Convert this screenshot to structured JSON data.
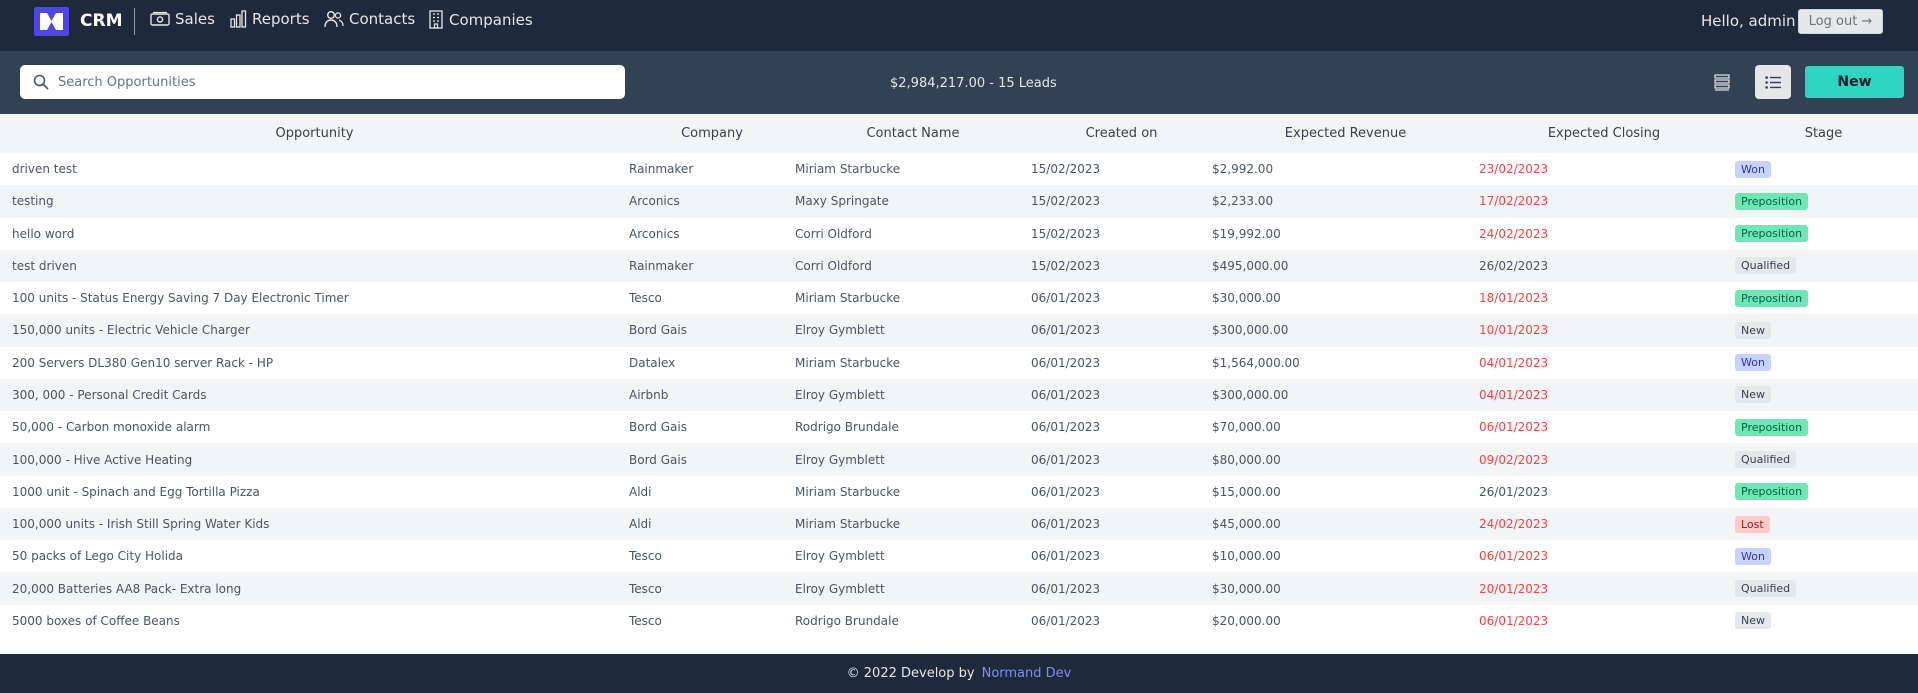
{
  "nav": {
    "brand": "CRM",
    "items": [
      {
        "label": "Sales",
        "icon": "money-icon"
      },
      {
        "label": "Reports",
        "icon": "bar-chart-icon"
      },
      {
        "label": "Contacts",
        "icon": "users-icon"
      },
      {
        "label": "Companies",
        "icon": "building-icon"
      }
    ],
    "greeting": "Hello, admin",
    "logout_label": "Log out →"
  },
  "toolbar": {
    "search_placeholder": "Search Opportunities",
    "summary": "$2,984,217.00 - 15 Leads",
    "new_label": "New"
  },
  "table": {
    "headers": [
      "Opportunity",
      "Company",
      "Contact Name",
      "Created on",
      "Expected Revenue",
      "Expected Closing",
      "Stage"
    ],
    "rows": [
      {
        "opportunity": "driven test",
        "company": "Rainmaker",
        "contact": "Miriam Starbucke",
        "created": "15/02/2023",
        "revenue": "$2,992.00",
        "closing": "23/02/2023",
        "closing_late": true,
        "stage": "Won"
      },
      {
        "opportunity": "testing",
        "company": "Arconics",
        "contact": "Maxy Springate",
        "created": "15/02/2023",
        "revenue": "$2,233.00",
        "closing": "17/02/2023",
        "closing_late": true,
        "stage": "Preposition"
      },
      {
        "opportunity": "hello word",
        "company": "Arconics",
        "contact": "Corri Oldford",
        "created": "15/02/2023",
        "revenue": "$19,992.00",
        "closing": "24/02/2023",
        "closing_late": true,
        "stage": "Preposition"
      },
      {
        "opportunity": "test driven",
        "company": "Rainmaker",
        "contact": "Corri Oldford",
        "created": "15/02/2023",
        "revenue": "$495,000.00",
        "closing": "26/02/2023",
        "closing_late": false,
        "stage": "Qualified"
      },
      {
        "opportunity": "100 units - Status Energy Saving 7 Day Electronic Timer",
        "company": "Tesco",
        "contact": "Miriam Starbucke",
        "created": "06/01/2023",
        "revenue": "$30,000.00",
        "closing": "18/01/2023",
        "closing_late": true,
        "stage": "Preposition"
      },
      {
        "opportunity": "150,000 units - Electric Vehicle Charger",
        "company": "Bord Gais",
        "contact": "Elroy Gymblett",
        "created": "06/01/2023",
        "revenue": "$300,000.00",
        "closing": "10/01/2023",
        "closing_late": true,
        "stage": "New"
      },
      {
        "opportunity": "200 Servers DL380 Gen10 server Rack - HP",
        "company": "Datalex",
        "contact": "Miriam Starbucke",
        "created": "06/01/2023",
        "revenue": "$1,564,000.00",
        "closing": "04/01/2023",
        "closing_late": true,
        "stage": "Won"
      },
      {
        "opportunity": "300, 000 - Personal Credit Cards",
        "company": "Airbnb",
        "contact": "Elroy Gymblett",
        "created": "06/01/2023",
        "revenue": "$300,000.00",
        "closing": "04/01/2023",
        "closing_late": true,
        "stage": "New"
      },
      {
        "opportunity": "50,000 - Carbon monoxide alarm",
        "company": "Bord Gais",
        "contact": "Rodrigo Brundale",
        "created": "06/01/2023",
        "revenue": "$70,000.00",
        "closing": "06/01/2023",
        "closing_late": true,
        "stage": "Preposition"
      },
      {
        "opportunity": "100,000 - Hive Active Heating",
        "company": "Bord Gais",
        "contact": "Elroy Gymblett",
        "created": "06/01/2023",
        "revenue": "$80,000.00",
        "closing": "09/02/2023",
        "closing_late": true,
        "stage": "Qualified"
      },
      {
        "opportunity": "1000 unit - Spinach and Egg Tortilla Pizza",
        "company": "Aldi",
        "contact": "Miriam Starbucke",
        "created": "06/01/2023",
        "revenue": "$15,000.00",
        "closing": "26/01/2023",
        "closing_late": false,
        "stage": "Preposition"
      },
      {
        "opportunity": "100,000 units - Irish Still Spring Water Kids",
        "company": "Aldi",
        "contact": "Miriam Starbucke",
        "created": "06/01/2023",
        "revenue": "$45,000.00",
        "closing": "24/02/2023",
        "closing_late": true,
        "stage": "Lost"
      },
      {
        "opportunity": "50 packs of Lego City Holida",
        "company": "Tesco",
        "contact": "Elroy Gymblett",
        "created": "06/01/2023",
        "revenue": "$10,000.00",
        "closing": "06/01/2023",
        "closing_late": true,
        "stage": "Won"
      },
      {
        "opportunity": "20,000 Batteries AA8 Pack- Extra long",
        "company": "Tesco",
        "contact": "Elroy Gymblett",
        "created": "06/01/2023",
        "revenue": "$30,000.00",
        "closing": "20/01/2023",
        "closing_late": true,
        "stage": "Qualified"
      },
      {
        "opportunity": "5000 boxes of Coffee Beans",
        "company": "Tesco",
        "contact": "Rodrigo Brundale",
        "created": "06/01/2023",
        "revenue": "$20,000.00",
        "closing": "06/01/2023",
        "closing_late": true,
        "stage": "New"
      }
    ]
  },
  "stage_colors": {
    "Won": {
      "bg": "#c7d2fe",
      "fg": "#3730a3"
    },
    "Preposition": {
      "bg": "#6ee7b7",
      "fg": "#065f46"
    },
    "Qualified": {
      "bg": "#e5e7eb",
      "fg": "#374151"
    },
    "New": {
      "bg": "#e5e7eb",
      "fg": "#374151"
    },
    "Lost": {
      "bg": "#fecaca",
      "fg": "#991b1b"
    }
  },
  "colors": {
    "nav_bg": "#1e293b",
    "toolbar_bg": "#334155",
    "accent": "#2dd4bf",
    "late_date": "#ef4444",
    "footer_link": "#818cf8"
  },
  "footer": {
    "text": "© 2022 Develop by",
    "link": "Normand Dev"
  }
}
